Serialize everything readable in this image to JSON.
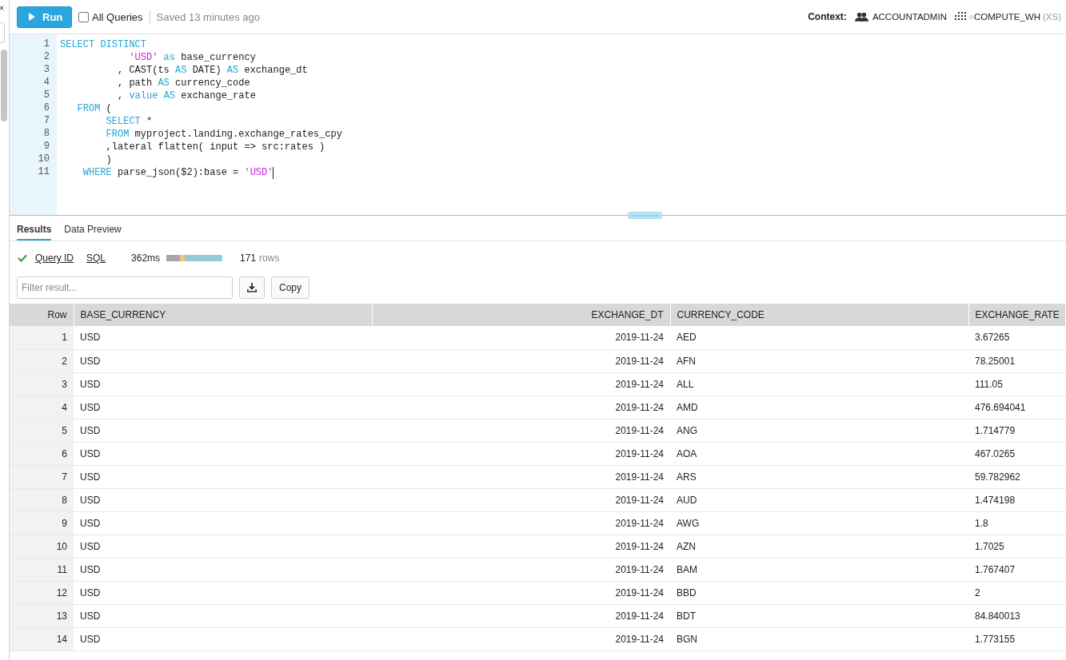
{
  "toolbar": {
    "run_label": "Run",
    "all_queries": {
      "label": "All Queries",
      "checked": false
    },
    "saved": "Saved 13 minutes ago",
    "context_label": "Context:",
    "role": "ACCOUNTADMIN",
    "warehouse": "COMPUTE_WH",
    "warehouse_size": "(XS)"
  },
  "editor": {
    "lines": [
      {
        "number": "1",
        "tokens": [
          {
            "text": "SELECT DISTINCT",
            "kind": "keyword"
          }
        ]
      },
      {
        "number": "2",
        "tokens": [
          {
            "text": "            'USD'",
            "kind": "string"
          },
          {
            "text": " as",
            "kind": "keyword"
          },
          {
            "text": " base_currency",
            "kind": "plain"
          }
        ]
      },
      {
        "number": "3",
        "tokens": [
          {
            "text": "          , CAST(ts ",
            "kind": "plain"
          },
          {
            "text": "AS",
            "kind": "keyword"
          },
          {
            "text": " DATE) ",
            "kind": "plain"
          },
          {
            "text": "AS",
            "kind": "keyword"
          },
          {
            "text": " exchange_dt",
            "kind": "plain"
          }
        ]
      },
      {
        "number": "4",
        "tokens": [
          {
            "text": "          , path ",
            "kind": "plain"
          },
          {
            "text": "AS",
            "kind": "keyword"
          },
          {
            "text": " currency_code",
            "kind": "plain"
          }
        ]
      },
      {
        "number": "5",
        "tokens": [
          {
            "text": "          , ",
            "kind": "plain"
          },
          {
            "text": "value",
            "kind": "keyword"
          },
          {
            "text": " AS",
            "kind": "keyword"
          },
          {
            "text": " exchange_rate",
            "kind": "plain"
          }
        ]
      },
      {
        "number": "6",
        "tokens": [
          {
            "text": "   FROM",
            "kind": "keyword"
          },
          {
            "text": " (",
            "kind": "plain"
          }
        ]
      },
      {
        "number": "7",
        "tokens": [
          {
            "text": "        SELECT",
            "kind": "keyword"
          },
          {
            "text": " *",
            "kind": "plain"
          }
        ]
      },
      {
        "number": "8",
        "tokens": [
          {
            "text": "        FROM",
            "kind": "keyword"
          },
          {
            "text": " myproject.landing.exchange_rates_cpy",
            "kind": "plain"
          }
        ]
      },
      {
        "number": "9",
        "tokens": [
          {
            "text": "        ,lateral flatten( input => src:rates )",
            "kind": "plain"
          }
        ]
      },
      {
        "number": "10",
        "tokens": [
          {
            "text": "        )",
            "kind": "plain"
          }
        ]
      },
      {
        "number": "11",
        "tokens": [
          {
            "text": "    WHERE",
            "kind": "keyword"
          },
          {
            "text": " parse_json($2):base = ",
            "kind": "plain"
          },
          {
            "text": "'USD'",
            "kind": "string"
          }
        ]
      }
    ]
  },
  "tabs": [
    {
      "label": "Results",
      "selected": true
    },
    {
      "label": "Data Preview",
      "selected": false
    }
  ],
  "status": {
    "query_id": "Query ID",
    "sql": "SQL",
    "duration": "362ms",
    "row_count": "171",
    "rows_label": "rows"
  },
  "filter": {
    "placeholder": "Filter result..."
  },
  "copy_label": "Copy",
  "table": {
    "columns": [
      "Row",
      "BASE_CURRENCY",
      "EXCHANGE_DT",
      "CURRENCY_CODE",
      "EXCHANGE_RATE"
    ],
    "rows": [
      [
        "1",
        "USD",
        "2019-11-24",
        "AED",
        "3.67265"
      ],
      [
        "2",
        "USD",
        "2019-11-24",
        "AFN",
        "78.25001"
      ],
      [
        "3",
        "USD",
        "2019-11-24",
        "ALL",
        "111.05"
      ],
      [
        "4",
        "USD",
        "2019-11-24",
        "AMD",
        "476.694041"
      ],
      [
        "5",
        "USD",
        "2019-11-24",
        "ANG",
        "1.714779"
      ],
      [
        "6",
        "USD",
        "2019-11-24",
        "AOA",
        "467.0265"
      ],
      [
        "7",
        "USD",
        "2019-11-24",
        "ARS",
        "59.782962"
      ],
      [
        "8",
        "USD",
        "2019-11-24",
        "AUD",
        "1.474198"
      ],
      [
        "9",
        "USD",
        "2019-11-24",
        "AWG",
        "1.8"
      ],
      [
        "10",
        "USD",
        "2019-11-24",
        "AZN",
        "1.7025"
      ],
      [
        "11",
        "USD",
        "2019-11-24",
        "BAM",
        "1.767407"
      ],
      [
        "12",
        "USD",
        "2019-11-24",
        "BBD",
        "2"
      ],
      [
        "13",
        "USD",
        "2019-11-24",
        "BDT",
        "84.840013"
      ],
      [
        "14",
        "USD",
        "2019-11-24",
        "BGN",
        "1.773155"
      ]
    ]
  }
}
